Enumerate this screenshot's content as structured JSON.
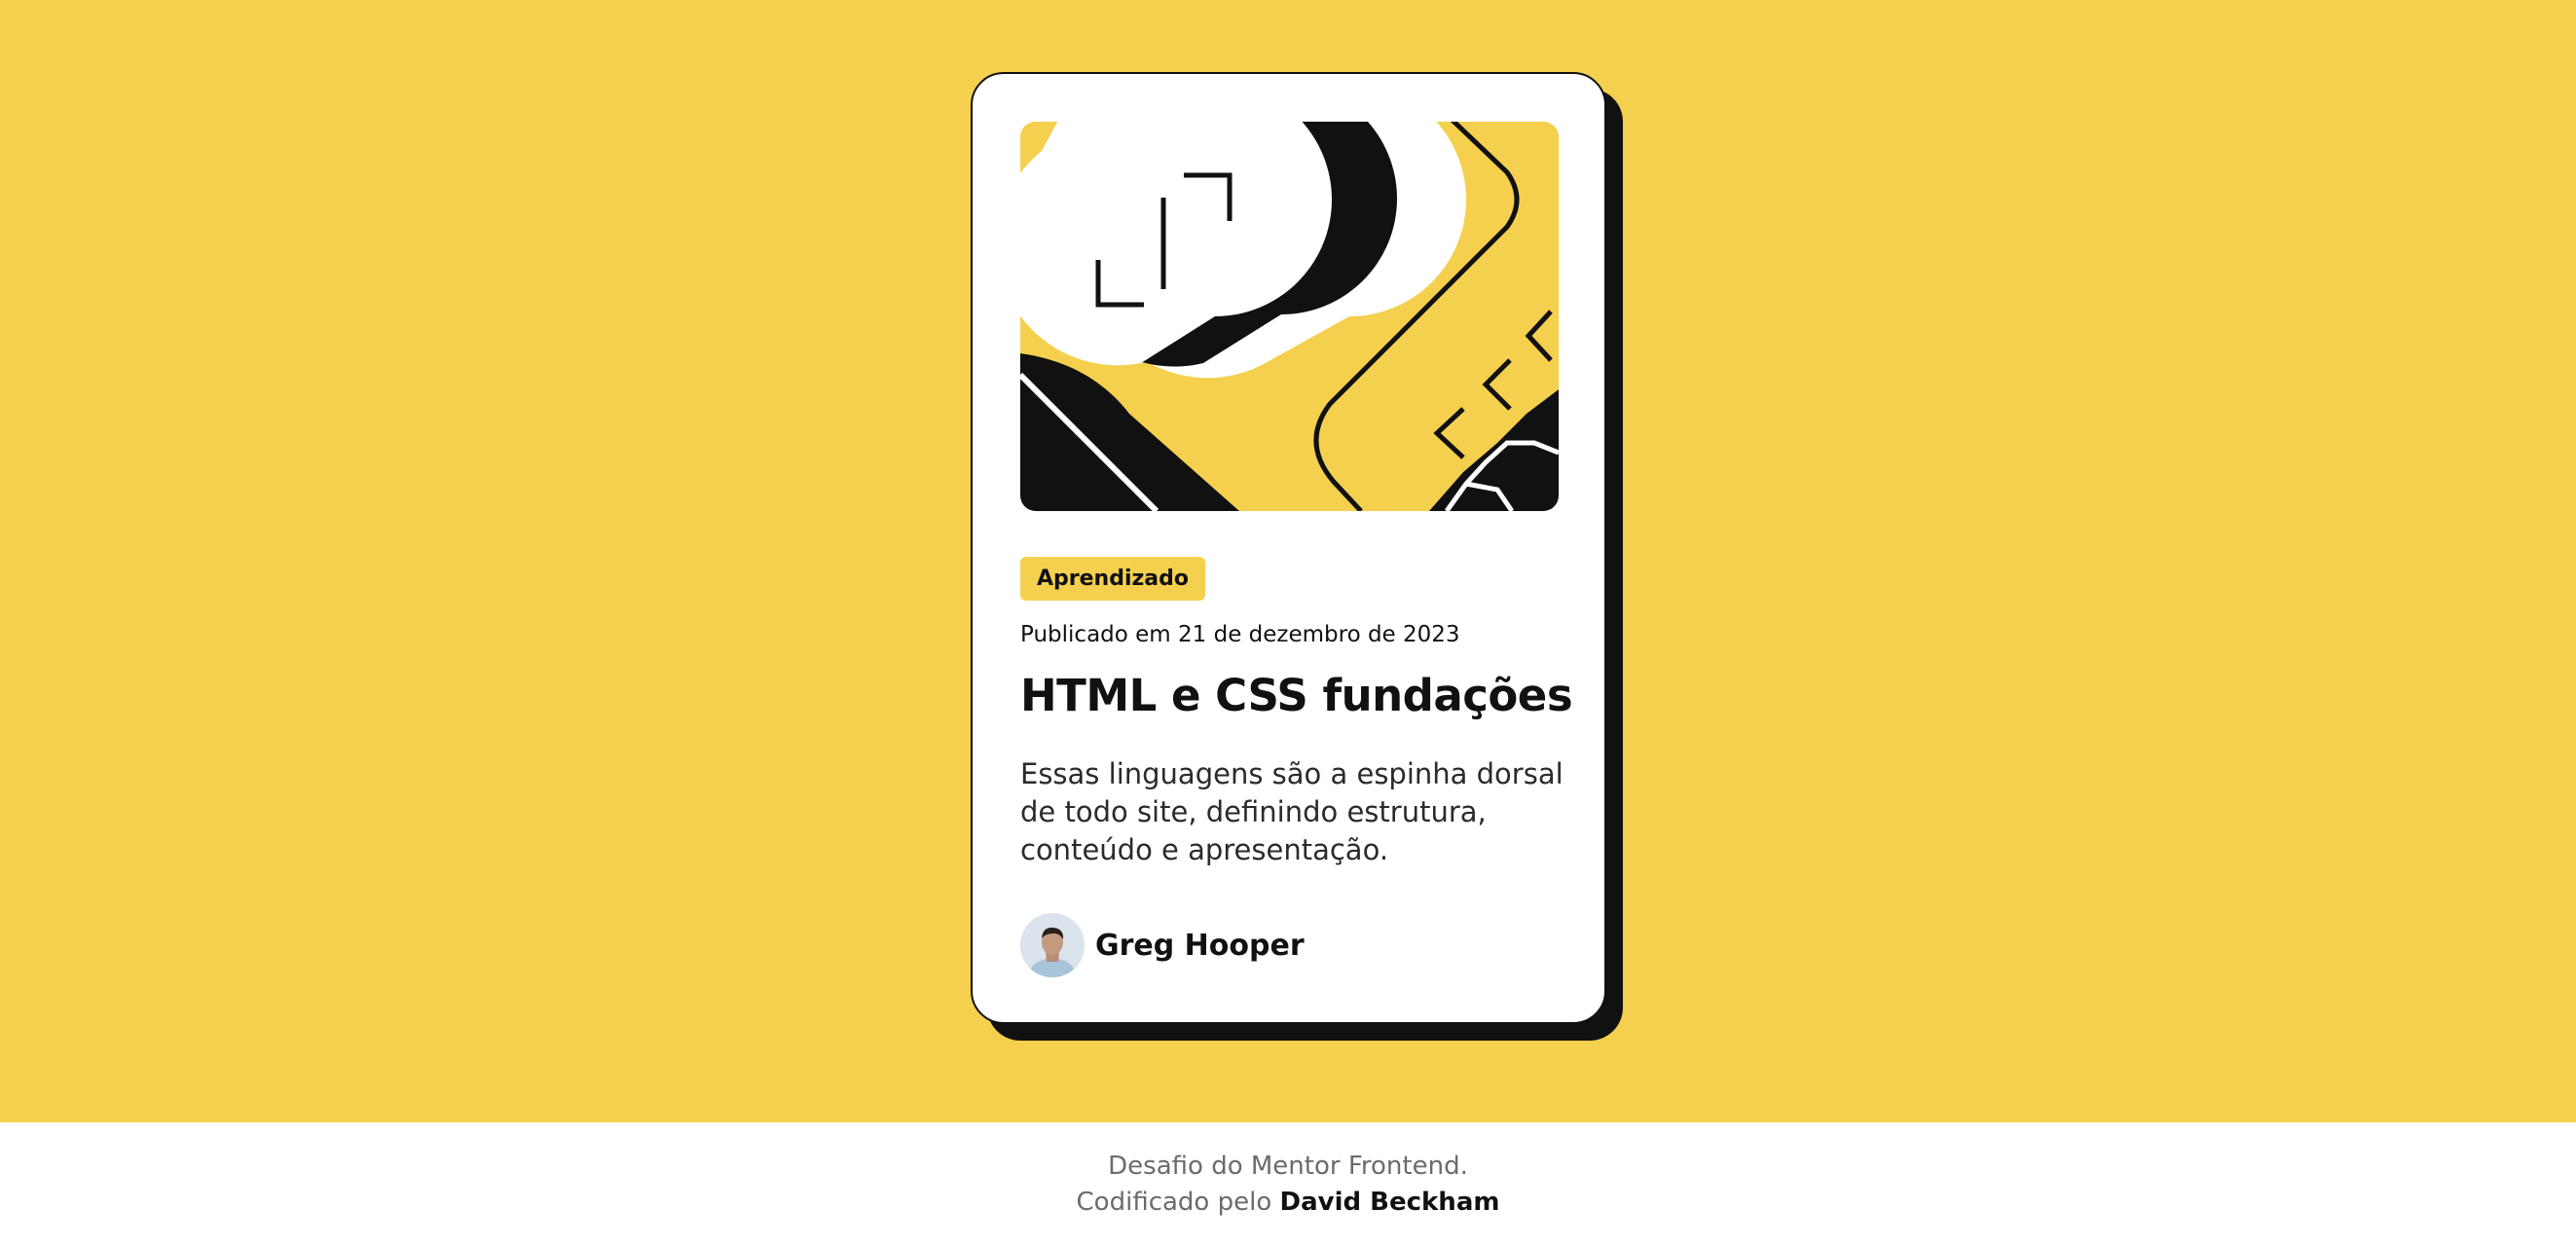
{
  "card": {
    "tag": "Aprendizado",
    "published": "Publicado em 21 de dezembro de 2023",
    "title": "HTML e CSS fundações",
    "description": "Essas linguagens são a espinha dorsal de todo site, definindo estrutura, conteúdo e apresentação.",
    "author": "Greg Hooper"
  },
  "attribution": {
    "line1": "Desafio do Mentor Frontend.",
    "line2_prefix": "Codificado pelo",
    "line2_author": "David Beckham"
  },
  "colors": {
    "background": "#F4D04E",
    "ink": "#111111",
    "card": "#FFFFFF",
    "footer_text": "#6B6B6B"
  },
  "icons": {
    "hero": "illustration-article",
    "avatar": "avatar-portrait"
  }
}
